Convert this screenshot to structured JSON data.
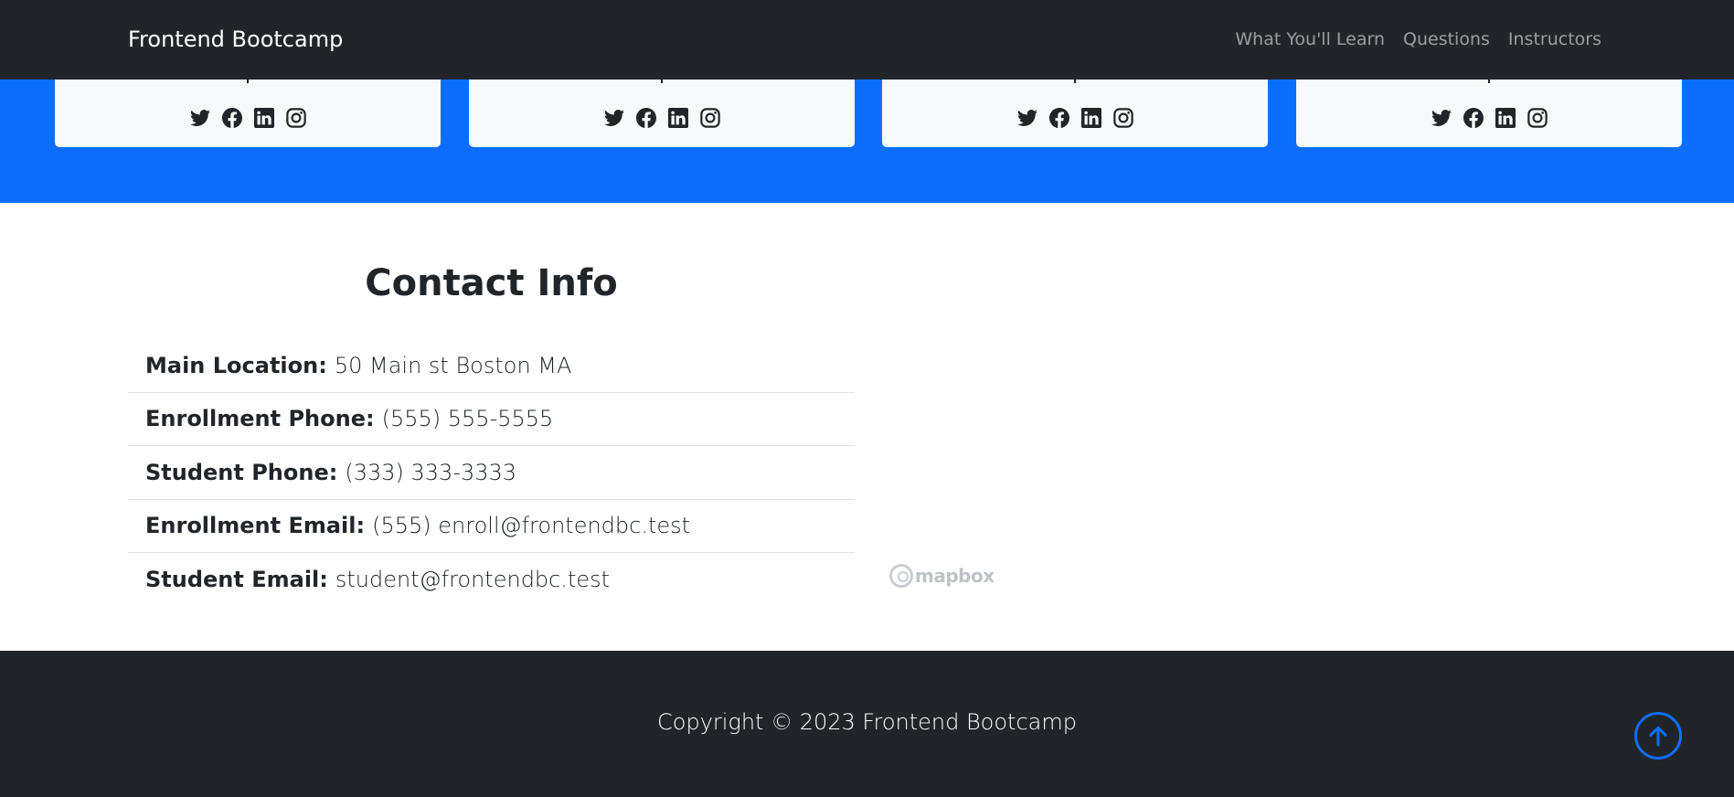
{
  "navbar": {
    "brand": "Frontend Bootcamp",
    "links": [
      "What You'll Learn",
      "Questions",
      "Instructors"
    ]
  },
  "instructors": {
    "cards": [
      {
        "socials": [
          "twitter-icon",
          "facebook-icon",
          "linkedin-icon",
          "instagram-icon"
        ]
      },
      {
        "socials": [
          "twitter-icon",
          "facebook-icon",
          "linkedin-icon",
          "instagram-icon"
        ]
      },
      {
        "socials": [
          "twitter-icon",
          "facebook-icon",
          "linkedin-icon",
          "instagram-icon"
        ]
      },
      {
        "socials": [
          "twitter-icon",
          "facebook-icon",
          "linkedin-icon",
          "instagram-icon"
        ]
      }
    ]
  },
  "contact": {
    "title": "Contact Info",
    "items": [
      {
        "label": "Main Location:",
        "value": "50 Main st Boston MA"
      },
      {
        "label": "Enrollment Phone:",
        "value": "(555) 555-5555"
      },
      {
        "label": "Student Phone:",
        "value": "(333) 333-3333"
      },
      {
        "label": "Enrollment Email:",
        "value": "(555) enroll@frontendbc.test"
      },
      {
        "label": "Student Email:",
        "value": "student@frontendbc.test"
      }
    ],
    "map_attribution": "mapbox"
  },
  "footer": {
    "copyright": "Copyright © 2023 Frontend Bootcamp",
    "to_top_icon": "arrow-up-circle-icon"
  },
  "colors": {
    "navbar_bg": "#212529",
    "primary": "#0d6efd",
    "card_bg": "#f8f9fa"
  }
}
